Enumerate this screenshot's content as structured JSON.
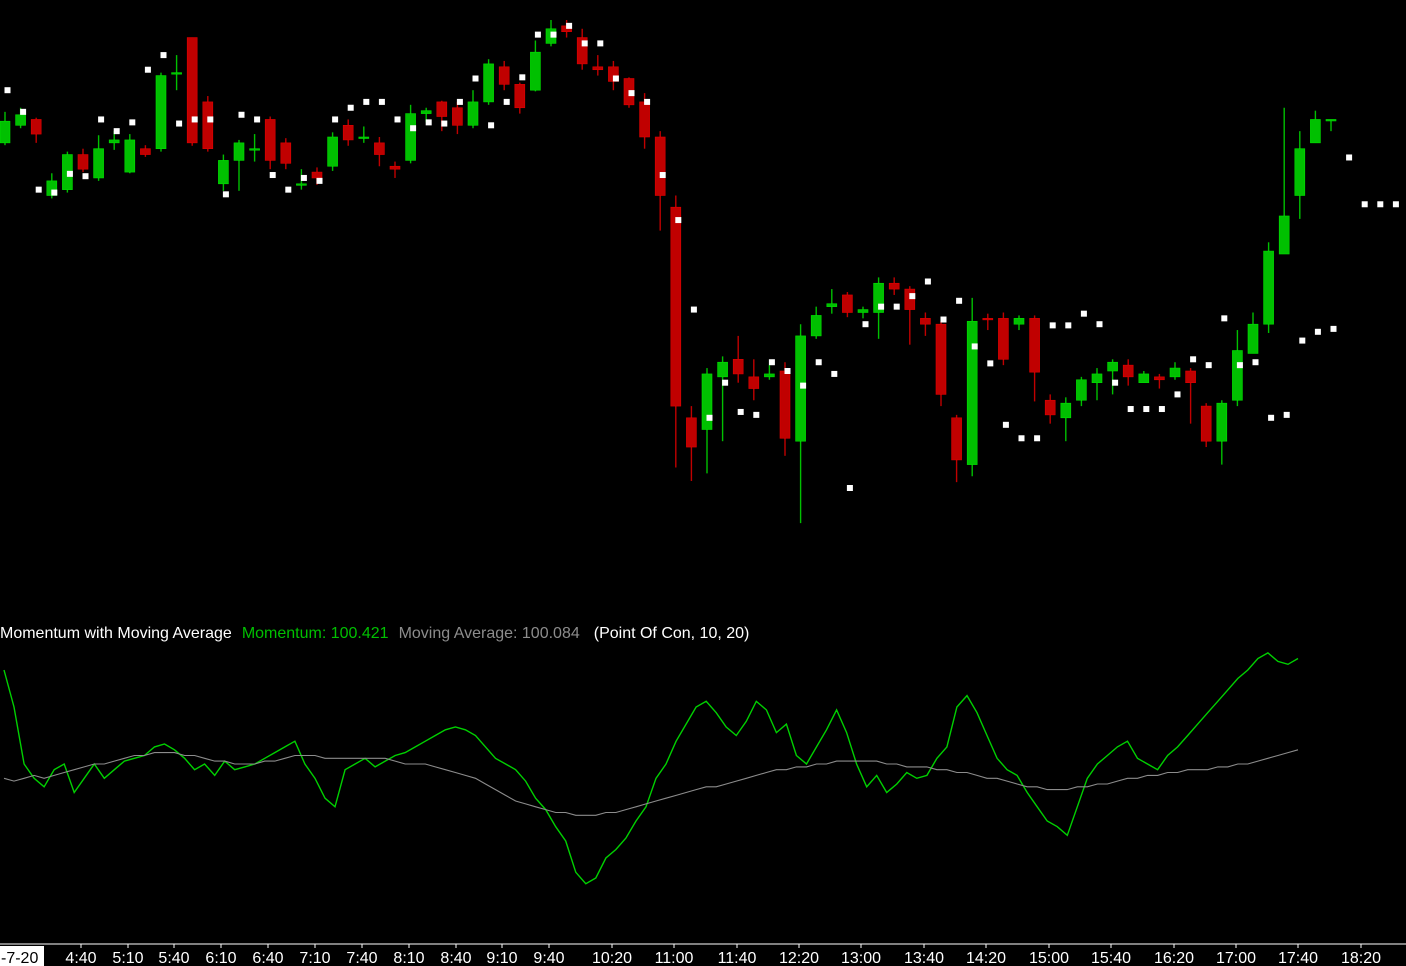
{
  "colors": {
    "background": "#000000",
    "up": "#00c000",
    "down": "#c00000",
    "momentum": "#00d000",
    "moving_average": "#8c8c8c",
    "stops": "#ffffff"
  },
  "indicator_legend": {
    "name": "Momentum with Moving Average",
    "momentum": "Momentum: 100.421",
    "moving_average": "Moving Average: 100.084",
    "params": "(Point Of Con, 10, 20)"
  },
  "chart_data": [
    {
      "type": "candlestick",
      "title": "",
      "xlabel": "",
      "ylabel": "",
      "x_date_label": "-7-20",
      "x_tick_labels": [
        "4:40",
        "5:10",
        "5:40",
        "6:10",
        "6:40",
        "7:10",
        "7:40",
        "8:10",
        "8:40",
        "9:10",
        "9:40",
        "10:20",
        "11:00",
        "11:40",
        "12:20",
        "13:00",
        "13:40",
        "14:20",
        "15:00",
        "15:40",
        "16:20",
        "17:00",
        "17:40",
        "18:20"
      ],
      "ylim": [
        0,
        1
      ],
      "grid": false,
      "candles": [
        [
          0.79,
          0.827,
          0.843,
          0.786
        ],
        [
          0.82,
          0.838,
          0.85,
          0.815
        ],
        [
          0.83,
          0.805,
          0.833,
          0.79
        ],
        [
          0.7,
          0.725,
          0.738,
          0.695
        ],
        [
          0.71,
          0.77,
          0.775,
          0.705
        ],
        [
          0.77,
          0.745,
          0.78,
          0.74
        ],
        [
          0.73,
          0.78,
          0.803,
          0.725
        ],
        [
          0.79,
          0.795,
          0.81,
          0.778
        ],
        [
          0.74,
          0.795,
          0.805,
          0.738
        ],
        [
          0.78,
          0.77,
          0.786,
          0.766
        ],
        [
          0.78,
          0.905,
          0.91,
          0.775
        ],
        [
          0.91,
          0.91,
          0.94,
          0.88
        ],
        [
          0.97,
          0.79,
          0.97,
          0.785
        ],
        [
          0.86,
          0.78,
          0.87,
          0.775
        ],
        [
          0.72,
          0.76,
          0.77,
          0.708
        ],
        [
          0.76,
          0.79,
          0.795,
          0.708
        ],
        [
          0.78,
          0.78,
          0.805,
          0.758
        ],
        [
          0.83,
          0.76,
          0.835,
          0.745
        ],
        [
          0.79,
          0.755,
          0.798,
          0.745
        ],
        [
          0.72,
          0.72,
          0.745,
          0.71
        ],
        [
          0.74,
          0.73,
          0.748,
          0.718
        ],
        [
          0.75,
          0.8,
          0.808,
          0.742
        ],
        [
          0.82,
          0.795,
          0.83,
          0.785
        ],
        [
          0.8,
          0.8,
          0.818,
          0.79
        ],
        [
          0.79,
          0.77,
          0.8,
          0.75
        ],
        [
          0.75,
          0.745,
          0.758,
          0.73
        ],
        [
          0.76,
          0.84,
          0.855,
          0.755
        ],
        [
          0.84,
          0.845,
          0.85,
          0.825
        ],
        [
          0.86,
          0.835,
          0.862,
          0.81
        ],
        [
          0.85,
          0.82,
          0.86,
          0.805
        ],
        [
          0.82,
          0.86,
          0.88,
          0.815
        ],
        [
          0.86,
          0.925,
          0.933,
          0.855
        ],
        [
          0.92,
          0.89,
          0.93,
          0.88
        ],
        [
          0.89,
          0.85,
          0.893,
          0.84
        ],
        [
          0.88,
          0.945,
          0.965,
          0.878
        ],
        [
          0.96,
          0.985,
          1.0,
          0.955
        ],
        [
          0.99,
          0.98,
          1.0,
          0.97
        ],
        [
          0.97,
          0.925,
          0.985,
          0.915
        ],
        [
          0.92,
          0.915,
          0.94,
          0.905
        ],
        [
          0.92,
          0.895,
          0.93,
          0.88
        ],
        [
          0.9,
          0.855,
          0.902,
          0.85
        ],
        [
          0.86,
          0.8,
          0.875,
          0.78
        ],
        [
          0.8,
          0.7,
          0.81,
          0.64
        ],
        [
          0.68,
          0.34,
          0.7,
          0.235
        ],
        [
          0.32,
          0.27,
          0.34,
          0.212
        ],
        [
          0.3,
          0.395,
          0.405,
          0.225
        ],
        [
          0.39,
          0.415,
          0.425,
          0.28
        ],
        [
          0.42,
          0.395,
          0.46,
          0.38
        ],
        [
          0.39,
          0.37,
          0.42,
          0.35
        ],
        [
          0.39,
          0.395,
          0.41,
          0.385
        ],
        [
          0.4,
          0.285,
          0.415,
          0.255
        ],
        [
          0.28,
          0.46,
          0.48,
          0.14
        ],
        [
          0.46,
          0.495,
          0.51,
          0.455
        ],
        [
          0.51,
          0.515,
          0.54,
          0.498
        ],
        [
          0.53,
          0.5,
          0.535,
          0.492
        ],
        [
          0.5,
          0.505,
          0.51,
          0.49
        ],
        [
          0.5,
          0.55,
          0.56,
          0.455
        ],
        [
          0.55,
          0.54,
          0.56,
          0.53
        ],
        [
          0.54,
          0.505,
          0.545,
          0.445
        ],
        [
          0.49,
          0.48,
          0.5,
          0.46
        ],
        [
          0.48,
          0.36,
          0.485,
          0.34
        ],
        [
          0.32,
          0.248,
          0.325,
          0.21
        ],
        [
          0.24,
          0.485,
          0.525,
          0.22
        ],
        [
          0.49,
          0.488,
          0.498,
          0.47
        ],
        [
          0.49,
          0.42,
          0.5,
          0.41
        ],
        [
          0.48,
          0.49,
          0.495,
          0.47
        ],
        [
          0.49,
          0.398,
          0.495,
          0.348
        ],
        [
          0.35,
          0.325,
          0.36,
          0.31
        ],
        [
          0.32,
          0.345,
          0.355,
          0.28
        ],
        [
          0.35,
          0.385,
          0.39,
          0.34
        ],
        [
          0.38,
          0.395,
          0.405,
          0.35
        ],
        [
          0.4,
          0.415,
          0.42,
          0.36
        ],
        [
          0.41,
          0.39,
          0.42,
          0.375
        ],
        [
          0.38,
          0.395,
          0.4,
          0.38
        ],
        [
          0.39,
          0.385,
          0.395,
          0.37
        ],
        [
          0.39,
          0.405,
          0.415,
          0.385
        ],
        [
          0.4,
          0.38,
          0.405,
          0.31
        ],
        [
          0.34,
          0.28,
          0.345,
          0.27
        ],
        [
          0.28,
          0.345,
          0.35,
          0.24
        ],
        [
          0.35,
          0.435,
          0.47,
          0.34
        ],
        [
          0.43,
          0.48,
          0.5,
          0.43
        ],
        [
          0.48,
          0.605,
          0.62,
          0.465
        ],
        [
          0.6,
          0.665,
          0.85,
          0.6
        ],
        [
          0.7,
          0.78,
          0.81,
          0.66
        ],
        [
          0.79,
          0.83,
          0.845,
          0.79
        ],
        [
          0.83,
          0.83,
          0.83,
          0.81
        ]
      ],
      "stops": [
        0.88,
        0.843,
        0.71,
        0.705,
        0.737,
        0.733,
        0.83,
        0.81,
        0.825,
        0.915,
        0.94,
        0.823,
        0.83,
        0.83,
        0.702,
        0.838,
        0.83,
        0.735,
        0.71,
        0.73,
        0.725,
        0.83,
        0.85,
        0.86,
        0.86,
        0.83,
        0.815,
        0.825,
        0.823,
        0.86,
        0.9,
        0.82,
        0.86,
        0.902,
        0.975,
        0.975,
        0.99,
        0.96,
        0.96,
        0.9,
        0.875,
        0.86,
        0.735,
        0.658,
        0.505,
        0.32,
        0.38,
        0.33,
        0.325,
        0.415,
        0.4,
        0.375,
        0.415,
        0.395,
        0.2,
        0.48,
        0.51,
        0.51,
        0.528,
        0.553,
        0.488,
        0.52,
        0.442,
        0.413,
        0.308,
        0.285,
        0.285,
        0.478,
        0.478,
        0.498,
        0.48,
        0.38,
        0.335,
        0.335,
        0.335,
        0.36,
        0.42,
        0.41,
        0.49,
        0.41,
        0.415,
        0.32,
        0.325,
        0.452,
        0.467,
        0.472,
        0.765,
        0.685,
        0.685,
        0.685
      ]
    },
    {
      "type": "line",
      "title": "",
      "xlabel": "",
      "ylabel": "",
      "ylim": [
        0,
        1
      ],
      "series": [
        {
          "values": [
            0.93,
            0.8,
            0.6,
            0.55,
            0.52,
            0.58,
            0.6,
            0.5,
            0.55,
            0.6,
            0.55,
            0.58,
            0.61,
            0.62,
            0.63,
            0.66,
            0.67,
            0.65,
            0.62,
            0.58,
            0.6,
            0.56,
            0.61,
            0.58,
            0.59,
            0.6,
            0.62,
            0.64,
            0.66,
            0.68,
            0.6,
            0.55,
            0.48,
            0.45,
            0.58,
            0.6,
            0.62,
            0.59,
            0.61,
            0.63,
            0.64,
            0.66,
            0.68,
            0.7,
            0.72,
            0.73,
            0.72,
            0.7,
            0.66,
            0.62,
            0.6,
            0.58,
            0.54,
            0.48,
            0.44,
            0.38,
            0.33,
            0.22,
            0.18,
            0.2,
            0.27,
            0.3,
            0.34,
            0.4,
            0.45,
            0.55,
            0.6,
            0.68,
            0.74,
            0.8,
            0.82,
            0.78,
            0.73,
            0.7,
            0.75,
            0.82,
            0.79,
            0.71,
            0.74,
            0.63,
            0.6,
            0.66,
            0.72,
            0.79,
            0.71,
            0.6,
            0.52,
            0.56,
            0.5,
            0.53,
            0.57,
            0.55,
            0.56,
            0.62,
            0.66,
            0.8,
            0.84,
            0.78,
            0.7,
            0.62,
            0.58,
            0.56,
            0.5,
            0.45,
            0.4,
            0.38,
            0.35,
            0.45,
            0.55,
            0.6,
            0.63,
            0.66,
            0.68,
            0.62,
            0.6,
            0.58,
            0.63,
            0.66,
            0.7,
            0.74,
            0.78,
            0.82,
            0.86,
            0.9,
            0.93,
            0.97,
            0.99,
            0.96,
            0.95,
            0.97
          ]
        },
        {
          "values": [
            0.55,
            0.54,
            0.55,
            0.56,
            0.55,
            0.56,
            0.57,
            0.58,
            0.59,
            0.6,
            0.6,
            0.61,
            0.62,
            0.63,
            0.63,
            0.64,
            0.64,
            0.64,
            0.63,
            0.63,
            0.62,
            0.61,
            0.61,
            0.6,
            0.6,
            0.6,
            0.61,
            0.61,
            0.62,
            0.63,
            0.63,
            0.63,
            0.62,
            0.62,
            0.62,
            0.62,
            0.62,
            0.62,
            0.62,
            0.61,
            0.6,
            0.6,
            0.6,
            0.59,
            0.58,
            0.57,
            0.56,
            0.55,
            0.53,
            0.51,
            0.49,
            0.47,
            0.46,
            0.45,
            0.44,
            0.43,
            0.43,
            0.42,
            0.42,
            0.42,
            0.43,
            0.43,
            0.44,
            0.45,
            0.46,
            0.47,
            0.48,
            0.49,
            0.5,
            0.51,
            0.52,
            0.52,
            0.53,
            0.54,
            0.55,
            0.56,
            0.57,
            0.58,
            0.58,
            0.59,
            0.59,
            0.6,
            0.6,
            0.61,
            0.61,
            0.61,
            0.61,
            0.61,
            0.6,
            0.6,
            0.59,
            0.59,
            0.59,
            0.58,
            0.58,
            0.57,
            0.57,
            0.56,
            0.55,
            0.55,
            0.54,
            0.53,
            0.52,
            0.52,
            0.51,
            0.51,
            0.51,
            0.52,
            0.52,
            0.53,
            0.53,
            0.54,
            0.55,
            0.55,
            0.56,
            0.56,
            0.57,
            0.57,
            0.58,
            0.58,
            0.58,
            0.59,
            0.59,
            0.6,
            0.6,
            0.61,
            0.62,
            0.63,
            0.64,
            0.65
          ]
        }
      ]
    }
  ]
}
